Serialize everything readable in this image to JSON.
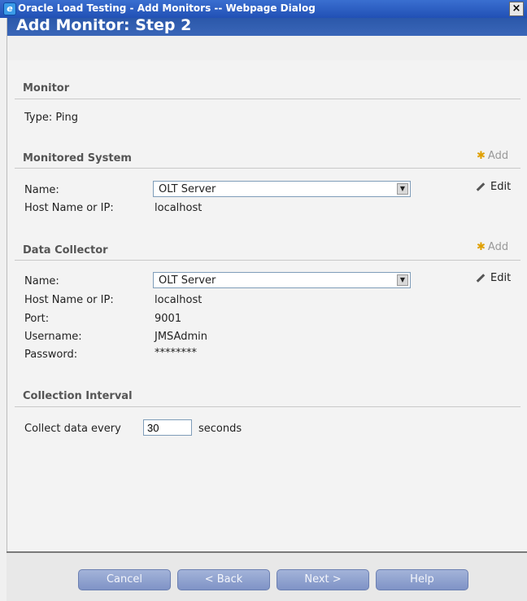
{
  "window": {
    "title": "Oracle Load Testing - Add Monitors -- Webpage Dialog",
    "close_glyph": "×"
  },
  "header": {
    "title": "Add Monitor: Step 2"
  },
  "monitor": {
    "section_title": "Monitor",
    "type_text": "Type: Ping"
  },
  "monitored_system": {
    "section_title": "Monitored System",
    "add_label": "Add",
    "edit_label": "Edit",
    "name_label": "Name:",
    "name_value": "OLT Server",
    "host_label": "Host Name or IP:",
    "host_value": "localhost"
  },
  "data_collector": {
    "section_title": "Data Collector",
    "add_label": "Add",
    "edit_label": "Edit",
    "name_label": "Name:",
    "name_value": "OLT Server",
    "host_label": "Host Name or IP:",
    "host_value": "localhost",
    "port_label": "Port:",
    "port_value": "9001",
    "username_label": "Username:",
    "username_value": "JMSAdmin",
    "password_label": "Password:",
    "password_value": "********"
  },
  "interval": {
    "section_title": "Collection Interval",
    "prefix": "Collect data every",
    "value": "30",
    "suffix": "seconds"
  },
  "buttons": {
    "cancel": "Cancel",
    "back": "< Back",
    "next": "Next >",
    "help": "Help"
  },
  "icons": {
    "window_icon": "ie-icon",
    "add": "add-star-icon",
    "edit": "pencil-icon",
    "dropdown": "chevron-down-icon"
  }
}
